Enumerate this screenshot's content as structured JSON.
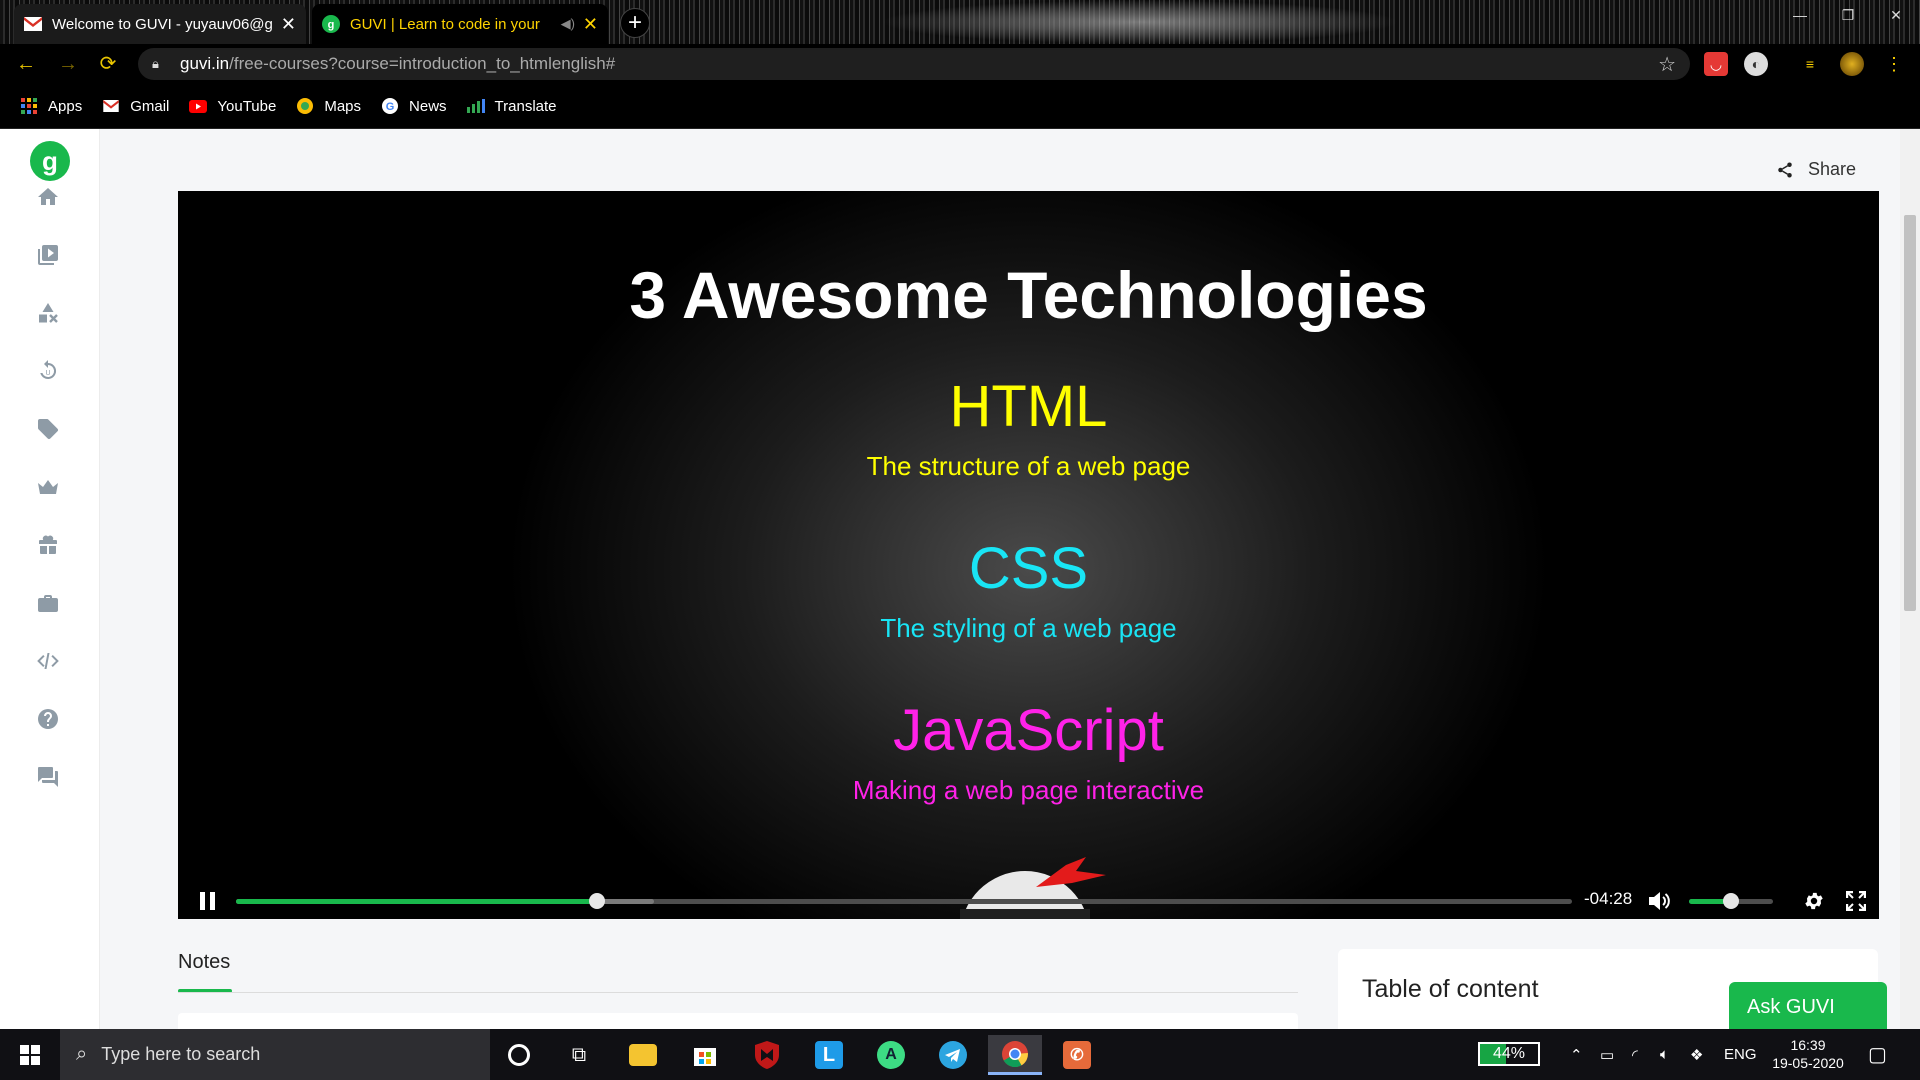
{
  "browser": {
    "tabs": [
      {
        "title": "Welcome to GUVI - yuyauv06@g",
        "favicon": "gmail-icon",
        "active": false
      },
      {
        "title": "GUVI | Learn to code in your",
        "favicon": "guvi-icon",
        "active": true
      }
    ],
    "new_tab_label": "+",
    "address": {
      "host": "guvi.in",
      "path": "/free-courses?course=introduction_to_htmlenglish#"
    },
    "bookmarks": [
      {
        "label": "Apps",
        "icon": "apps-grid-icon"
      },
      {
        "label": "Gmail",
        "icon": "gmail-icon"
      },
      {
        "label": "YouTube",
        "icon": "youtube-icon"
      },
      {
        "label": "Maps",
        "icon": "maps-icon"
      },
      {
        "label": "News",
        "icon": "google-news-icon"
      },
      {
        "label": "Translate",
        "icon": "translate-icon"
      }
    ]
  },
  "page": {
    "logo": "g",
    "share_label": "Share",
    "sidebar_icons": [
      "home-icon",
      "video-library-icon",
      "category-icon",
      "practice-icon",
      "tag-icon",
      "crown-icon",
      "gift-icon",
      "briefcase-icon",
      "code-icon",
      "help-icon",
      "forum-icon"
    ],
    "video": {
      "slide": {
        "title": "3 Awesome Technologies",
        "items": [
          {
            "name": "HTML",
            "desc": "The structure of a web page",
            "color": "#ffff00"
          },
          {
            "name": "CSS",
            "desc": "The styling of a web page",
            "color": "#19e5f5"
          },
          {
            "name": "JavaScript",
            "desc": "Making a web page interactive",
            "color": "#ff22e8"
          }
        ]
      },
      "time_remaining": "-04:28",
      "progress_fraction": 0.27,
      "buffered_fraction": 0.313,
      "volume_fraction": 0.5
    },
    "notes_tab_label": "Notes",
    "toc_title": "Table of content",
    "ask_label": "Ask GUVI",
    "accent_color": "#19b84c"
  },
  "taskbar": {
    "search_placeholder": "Type here to search",
    "battery": "44%",
    "language": "ENG",
    "time": "16:39",
    "date": "19-05-2020"
  }
}
